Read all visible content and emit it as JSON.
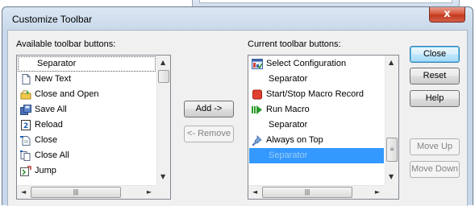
{
  "dialog": {
    "title": "Customize Toolbar",
    "close_glyph": "x"
  },
  "available": {
    "label": "Available toolbar buttons:",
    "items": [
      {
        "label": "Separator",
        "icon": "none"
      },
      {
        "label": "New Text",
        "icon": "new-text-icon"
      },
      {
        "label": "Close and Open",
        "icon": "close-and-open-icon"
      },
      {
        "label": "Save All",
        "icon": "save-all-icon"
      },
      {
        "label": "Reload",
        "icon": "reload-icon"
      },
      {
        "label": "Close",
        "icon": "close-doc-icon"
      },
      {
        "label": "Close All",
        "icon": "close-all-icon"
      },
      {
        "label": "Jump",
        "icon": "jump-icon"
      }
    ]
  },
  "current": {
    "label": "Current toolbar buttons:",
    "items": [
      {
        "label": "Select Configuration",
        "icon": "select-configuration-icon"
      },
      {
        "label": "Separator",
        "icon": "none"
      },
      {
        "label": "Start/Stop Macro Record",
        "icon": "macro-record-icon"
      },
      {
        "label": "Run Macro",
        "icon": "run-macro-icon"
      },
      {
        "label": "Separator",
        "icon": "none"
      },
      {
        "label": "Always on Top",
        "icon": "pushpin-icon"
      },
      {
        "label": "Separator",
        "icon": "none",
        "selected": true
      }
    ]
  },
  "buttons": {
    "add": "Add ->",
    "remove": "<- Remove",
    "close": "Close",
    "reset": "Reset",
    "help": "Help",
    "move_up": "Move Up",
    "move_down": "Move Down"
  },
  "scroll": {
    "up": "▲",
    "down": "▼",
    "left": "◄",
    "right": "►",
    "grip": "|||"
  },
  "colors": {
    "selection": "#3399ff",
    "default_button_border": "#3c7fb1"
  }
}
